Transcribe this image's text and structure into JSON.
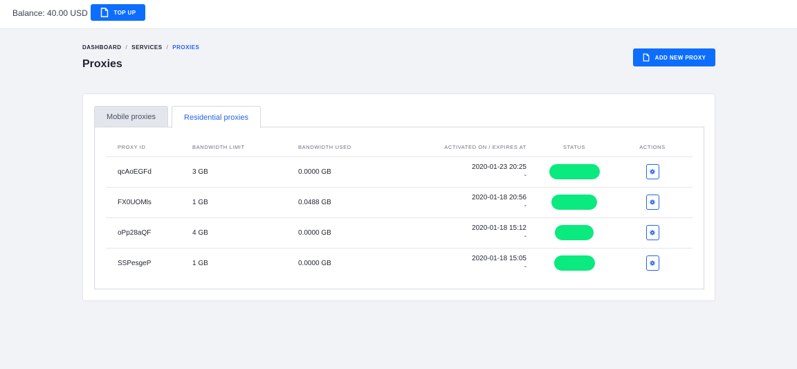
{
  "topbar": {
    "balance": "Balance: 40.00 USD",
    "topup_label": "TOP UP"
  },
  "breadcrumb": {
    "items": [
      "DASHBOARD",
      "SERVICES",
      "PROXIES"
    ],
    "separator": "/"
  },
  "page": {
    "title": "Proxies",
    "add_label": "ADD NEW PROXY"
  },
  "tabs": {
    "mobile": "Mobile proxies",
    "residential": "Residential proxies"
  },
  "table": {
    "headers": [
      "PROXY ID",
      "BANDWIDTH LIMIT",
      "BANDWIDTH USED",
      "ACTIVATED ON / EXPIRES AT",
      "STATUS",
      "ACTIONS"
    ],
    "rows": [
      {
        "id": "qcAoEGFd",
        "limit": "3 GB",
        "used": "0.0000 GB",
        "activated": "2020-01-23 20:25",
        "expires": "-"
      },
      {
        "id": "FX0UOMls",
        "limit": "1 GB",
        "used": "0.0488 GB",
        "activated": "2020-01-18 20:56",
        "expires": "-"
      },
      {
        "id": "oPp28aQF",
        "limit": "4 GB",
        "used": "0.0000 GB",
        "activated": "2020-01-18 15:12",
        "expires": "-"
      },
      {
        "id": "SSPesgeP",
        "limit": "1 GB",
        "used": "0.0000 GB",
        "activated": "2020-01-18 15:05",
        "expires": "-"
      }
    ]
  },
  "colors": {
    "primary": "#0d6efd",
    "status_active": "#0aea7e",
    "link": "#2563eb"
  },
  "icons": {
    "topup": "document-icon",
    "add": "document-icon",
    "action": "gear-icon"
  }
}
